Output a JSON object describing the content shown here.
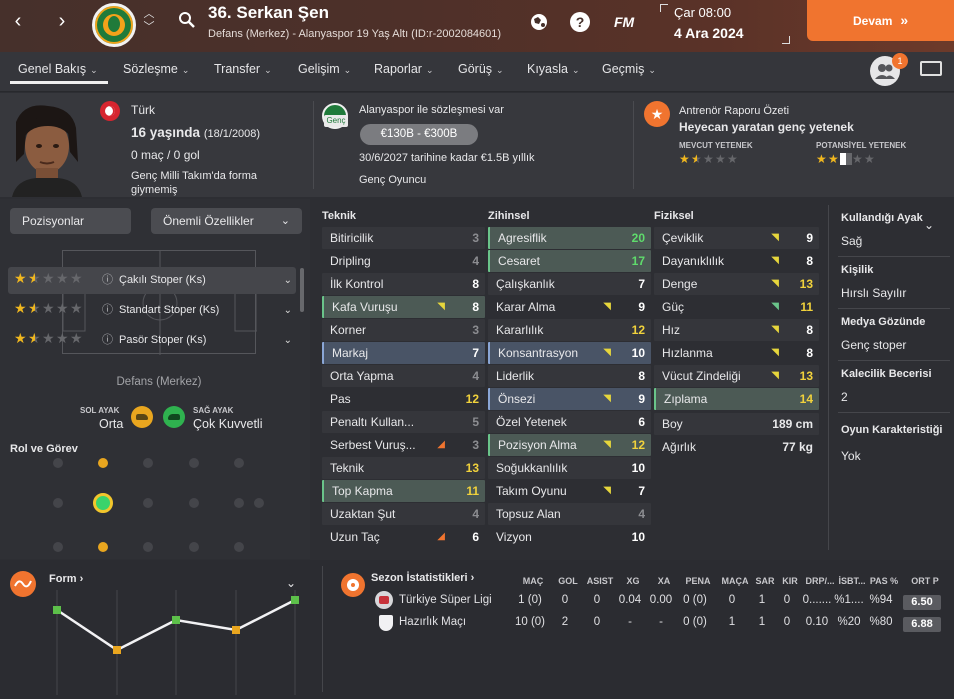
{
  "header": {
    "player_title": "36. Serkan Şen",
    "player_sub": "Defans (Merkez) - Alanyaspor 19 Yaş Altı (ID:r-2002084601)",
    "fm_label": "FM",
    "date_day": "Çar 08:00",
    "date_date": "4 Ara 2024",
    "continue_label": "Devam",
    "notification_count": "1"
  },
  "nav": {
    "items": [
      "Genel Bakış",
      "Sözleşme",
      "Transfer",
      "Gelişim",
      "Raporlar",
      "Görüş",
      "Kıyasla",
      "Geçmiş"
    ]
  },
  "info": {
    "nationality": "Türk",
    "age": "16 yaşında",
    "birth": "(18/1/2008)",
    "apps": "0 maç / 0 gol",
    "intl": "Genç Milli Takım'da forma giymemiş",
    "contract_club": "Alanyaspor ile sözleşmesi var",
    "contract_badge": "Genç",
    "value": "€130B - €300B",
    "contract_end": "30/6/2027 tarihine kadar €1.5B yıllık",
    "contract_type": "Genç Oyuncu",
    "report_title": "Antrenör Raporu Özeti",
    "report_summary": "Heyecan yaratan genç yetenek",
    "current_ability_label": "MEVCUT YETENEK",
    "potential_ability_label": "POTANSİYEL YETENEK",
    "current_ability_stars": 1.5,
    "potential_ability_stars": 2.5
  },
  "left": {
    "positions_btn": "Pozisyonlar",
    "features_btn": "Önemli Özellikler",
    "position_label": "Defans (Merkez)",
    "left_foot_label": "SOL AYAK",
    "left_foot_value": "Orta",
    "right_foot_label": "SAĞ AYAK",
    "right_foot_value": "Çok Kuvvetli",
    "roles_title": "Rol ve Görev",
    "roles": [
      {
        "label": "Çakılı Stoper (Ks)",
        "stars": 1.5
      },
      {
        "label": "Standart Stoper (Ks)",
        "stars": 1.5
      },
      {
        "label": "Pasör Stoper (Ks)",
        "stars": 1.5
      }
    ]
  },
  "attributes": {
    "technical_title": "Teknik",
    "mental_title": "Zihinsel",
    "physical_title": "Fiziksel",
    "technical": [
      {
        "name": "Bitiricilik",
        "value": "3"
      },
      {
        "name": "Dripling",
        "value": "4"
      },
      {
        "name": "İlk Kontrol",
        "value": "8"
      },
      {
        "name": "Kafa Vuruşu",
        "value": "8"
      },
      {
        "name": "Korner",
        "value": "3"
      },
      {
        "name": "Markaj",
        "value": "7"
      },
      {
        "name": "Orta Yapma",
        "value": "4"
      },
      {
        "name": "Pas",
        "value": "12"
      },
      {
        "name": "Penaltı Kullan...",
        "value": "5"
      },
      {
        "name": "Serbest Vuruş...",
        "value": "3"
      },
      {
        "name": "Teknik",
        "value": "13"
      },
      {
        "name": "Top Kapma",
        "value": "11"
      },
      {
        "name": "Uzaktan Şut",
        "value": "4"
      },
      {
        "name": "Uzun Taç",
        "value": "6"
      }
    ],
    "mental": [
      {
        "name": "Agresiflik",
        "value": "20"
      },
      {
        "name": "Cesaret",
        "value": "17"
      },
      {
        "name": "Çalışkanlık",
        "value": "7"
      },
      {
        "name": "Karar Alma",
        "value": "9"
      },
      {
        "name": "Kararlılık",
        "value": "12"
      },
      {
        "name": "Konsantrasyon",
        "value": "10"
      },
      {
        "name": "Liderlik",
        "value": "8"
      },
      {
        "name": "Önsezi",
        "value": "9"
      },
      {
        "name": "Özel Yetenek",
        "value": "6"
      },
      {
        "name": "Pozisyon Alma",
        "value": "12"
      },
      {
        "name": "Soğukkanlılık",
        "value": "10"
      },
      {
        "name": "Takım Oyunu",
        "value": "7"
      },
      {
        "name": "Topsuz Alan",
        "value": "4"
      },
      {
        "name": "Vizyon",
        "value": "10"
      }
    ],
    "physical": [
      {
        "name": "Çeviklik",
        "value": "9"
      },
      {
        "name": "Dayanıklılık",
        "value": "8"
      },
      {
        "name": "Denge",
        "value": "13"
      },
      {
        "name": "Güç",
        "value": "11"
      },
      {
        "name": "Hız",
        "value": "8"
      },
      {
        "name": "Hızlanma",
        "value": "8"
      },
      {
        "name": "Vücut Zindeliği",
        "value": "13"
      },
      {
        "name": "Zıplama",
        "value": "14"
      }
    ],
    "height_label": "Boy",
    "height_value": "189 cm",
    "weight_label": "Ağırlık",
    "weight_value": "77 kg"
  },
  "side": {
    "foot_title": "Kullandığı Ayak",
    "foot_value": "Sağ",
    "personality_title": "Kişilik",
    "personality_value": "Hırslı Sayılır",
    "media_title": "Medya Gözünde",
    "media_value": "Genç stoper",
    "gk_title": "Kalecilik Becerisi",
    "gk_value": "2",
    "character_title": "Oyun Karakteristiği",
    "character_value": "Yok"
  },
  "form": {
    "title": "Form",
    "ratings": [
      6.7,
      6.3,
      6.6,
      6.5,
      6.8
    ]
  },
  "stats": {
    "title": "Sezon İstatistikleri",
    "columns": [
      "MAÇ",
      "GOL",
      "ASIST",
      "XG",
      "XA",
      "PENA",
      "MAÇA",
      "SAR",
      "KIR",
      "DRP/...",
      "İSBT...",
      "PAS %",
      "ORT P"
    ],
    "rows": [
      {
        "comp": "Türkiye Süper Ligi",
        "cells": [
          "1 (0)",
          "0",
          "0",
          "0.04",
          "0.00",
          "0 (0)",
          "0",
          "1",
          "0",
          "0.......",
          "%1....",
          "%94"
        ],
        "rating": "6.50"
      },
      {
        "comp": "Hazırlık Maçı",
        "cells": [
          "10 (0)",
          "2",
          "0",
          "-",
          "-",
          "0 (0)",
          "1",
          "1",
          "0",
          "0.10",
          "%20",
          "%80"
        ],
        "rating": "6.88"
      }
    ]
  },
  "colors": {
    "accent": "#f0742f",
    "highlight_green": "#6ac48a",
    "value_yellow": "#f1d23c",
    "value_green": "#5fdc6c",
    "star": "#f0b71f"
  }
}
